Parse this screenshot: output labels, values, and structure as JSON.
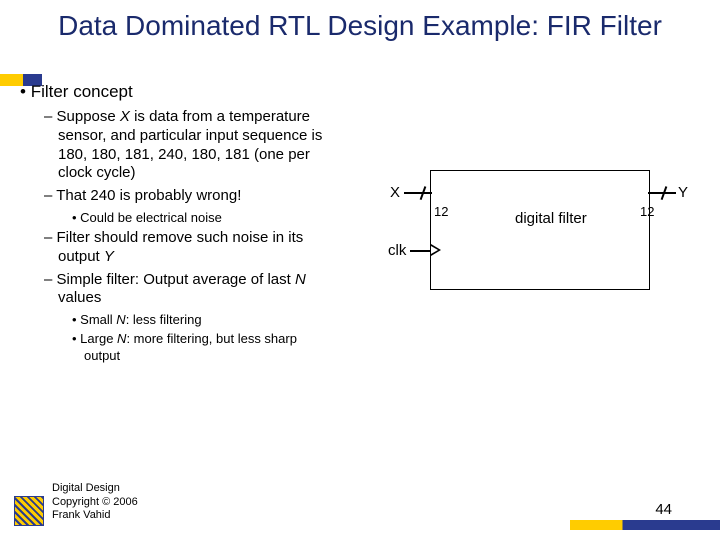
{
  "title": "Data Dominated RTL Design Example: FIR Filter",
  "bullets": {
    "concept": "Filter concept",
    "suppose_pre": "Suppose ",
    "suppose_var": "X",
    "suppose_post": " is data from a temperature sensor, and particular input sequence is 180, 180, 181, 240, 180, 181 (one per clock cycle)",
    "wrong": "That 240 is probably wrong!",
    "noise": "Could be electrical noise",
    "remove_pre": "Filter should remove such noise in its output ",
    "remove_var": "Y",
    "simple_pre": "Simple filter: Output average of last ",
    "simple_var": "N",
    "simple_post": " values",
    "small_pre": "Small ",
    "small_var": "N",
    "small_post": ": less filtering",
    "large_pre": "Large ",
    "large_var": "N",
    "large_post": ": more filtering, but less sharp output"
  },
  "diagram": {
    "x": "X",
    "y": "Y",
    "clk": "clk",
    "width": "12",
    "name": "digital filter"
  },
  "footer": {
    "l1": "Digital Design",
    "l2": "Copyright © 2006",
    "l3": "Frank Vahid"
  },
  "page": "44"
}
